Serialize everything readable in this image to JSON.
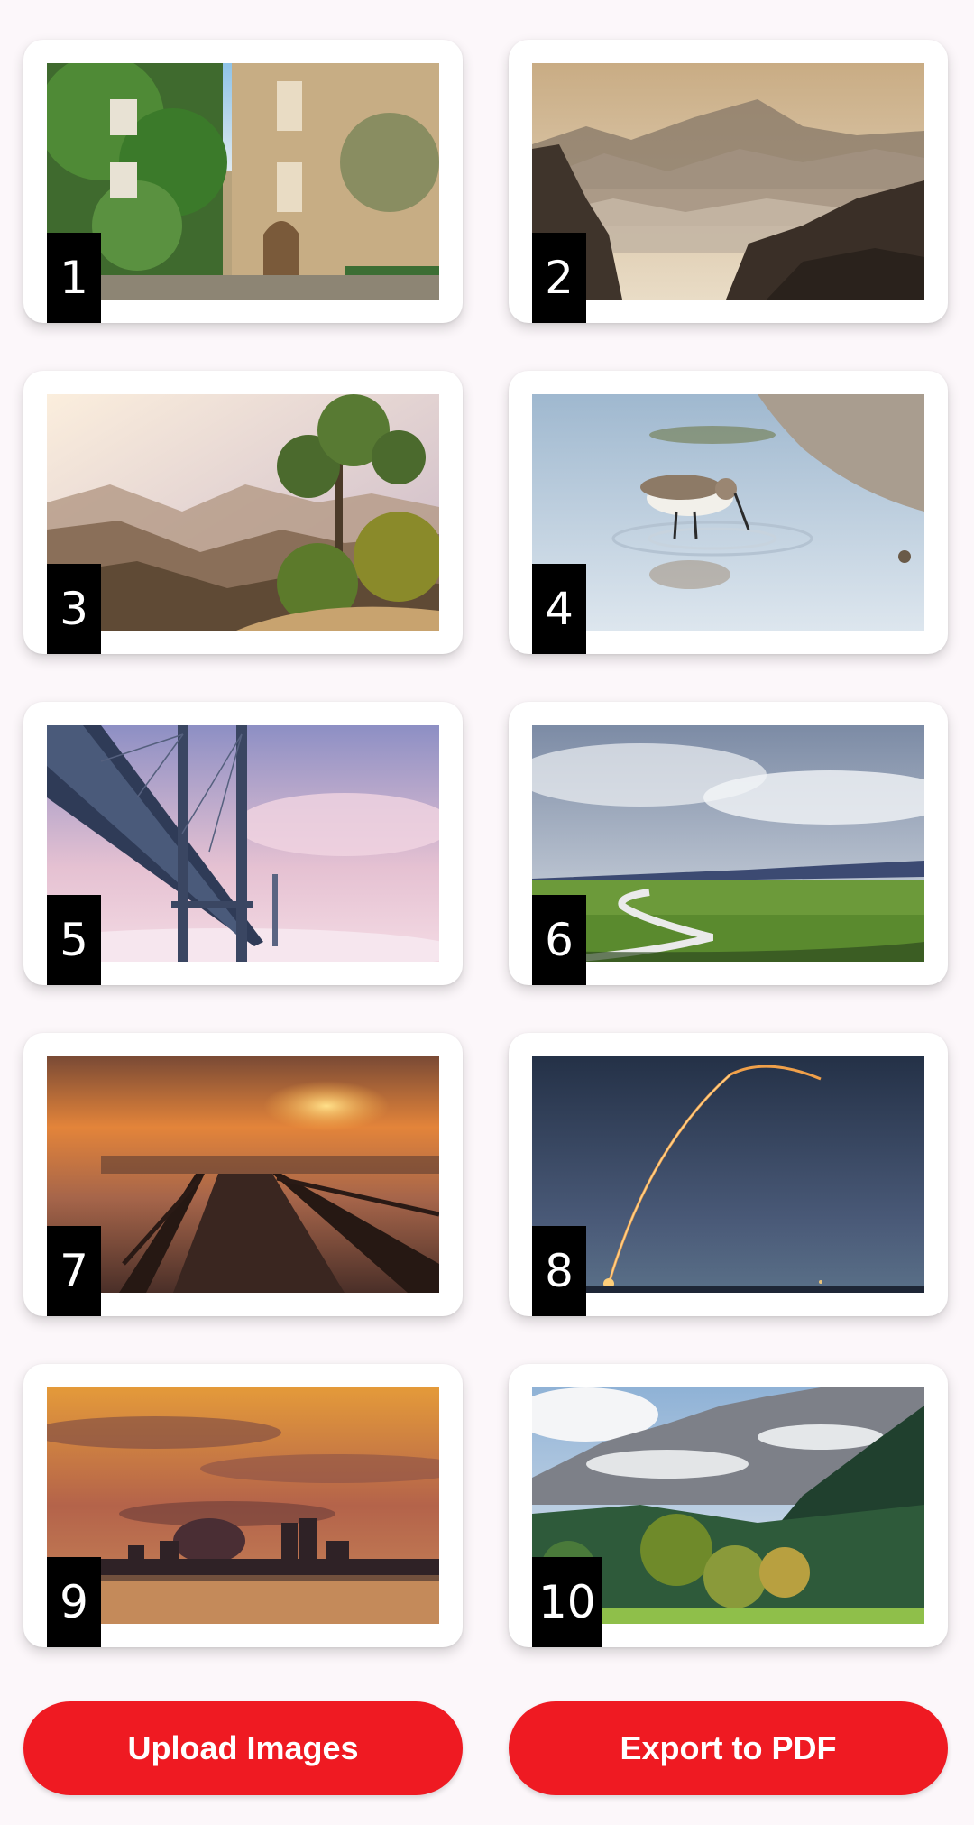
{
  "gallery": {
    "items": [
      {
        "number": "1",
        "subject": "ivy-covered stone street"
      },
      {
        "number": "2",
        "subject": "misty mountain ranges"
      },
      {
        "number": "3",
        "subject": "pine tree on mountain ridge"
      },
      {
        "number": "4",
        "subject": "sandpiper bird in water"
      },
      {
        "number": "5",
        "subject": "suspension bridge in fog"
      },
      {
        "number": "6",
        "subject": "winding road through grassland"
      },
      {
        "number": "7",
        "subject": "wooden pier at sunset"
      },
      {
        "number": "8",
        "subject": "rocket launch trail at night"
      },
      {
        "number": "9",
        "subject": "city skyline at sunset"
      },
      {
        "number": "10",
        "subject": "forest below rocky mountains"
      }
    ]
  },
  "actions": {
    "upload_label": "Upload Images",
    "export_label": "Export to PDF"
  },
  "colors": {
    "primary_button": "#ef1a22",
    "background": "#fcf7fa",
    "badge": "#000000"
  }
}
